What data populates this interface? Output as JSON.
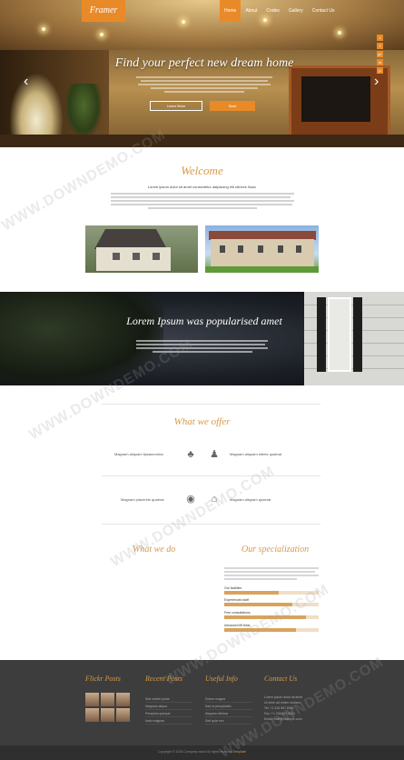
{
  "brand": {
    "logo": "Framer",
    "accent": "#e98a28",
    "title_color": "#d89a47"
  },
  "nav": {
    "items": [
      "Home",
      "About",
      "Codes",
      "Gallery",
      "Contact Us"
    ],
    "active": "Home"
  },
  "social": [
    "t",
    "f",
    "g+",
    "in",
    "p"
  ],
  "hero": {
    "title": "Find your perfect new dream home",
    "button_primary": "Learn More",
    "button_secondary": "Start"
  },
  "welcome": {
    "title": "Welcome",
    "subtitle": "Lorem ipsum dolor sit amet consectetur adipiscing elit ultrices Nunc"
  },
  "banner": {
    "title": "Lorem Ipsum was popularised amet"
  },
  "offer": {
    "title": "What we offer",
    "items": [
      "Magnam aliquam lipsamomics",
      "Magnam aliquam siterts quaerat",
      "Magnam placerets quaerat",
      "Magnam aliquam quaerat"
    ],
    "icons": [
      "tree-icon",
      "user-icon",
      "globe-icon",
      "home-icon"
    ]
  },
  "split": {
    "left_title": "What we do",
    "right_title": "Our specialization",
    "skills": [
      {
        "label": "Our facilities",
        "value": 0.58
      },
      {
        "label": "Experienced staff",
        "value": 0.72
      },
      {
        "label": "Free consultations",
        "value": 0.87
      },
      {
        "label": "Advanced lift tests",
        "value": 0.76
      }
    ]
  },
  "footer": {
    "titles": [
      "Flickr Posts",
      "Recent Posts",
      "Useful Info",
      "Contact Us"
    ],
    "recent_posts": [
      "Sed rudder posts",
      "Magnam aliqua",
      "Perspicia quisque",
      "Iusto magnas"
    ],
    "useful_info": [
      "Dolore magna",
      "Sed ut perspiciatis",
      "Aliquam minima",
      "Sed quia non"
    ],
    "contact": [
      "Lorem ipsum dolor sit amet",
      "Ut enim ad minim veniam",
      "Tel: +1 234 567 8901",
      "Fax: +1 234 567 8901",
      "Email: mail@example.com"
    ],
    "copyright": "Copyright © 2015 Company name All rights reserved",
    "copyright_link": "Template"
  },
  "watermark": "WWW.DOWNDEMO.COM"
}
